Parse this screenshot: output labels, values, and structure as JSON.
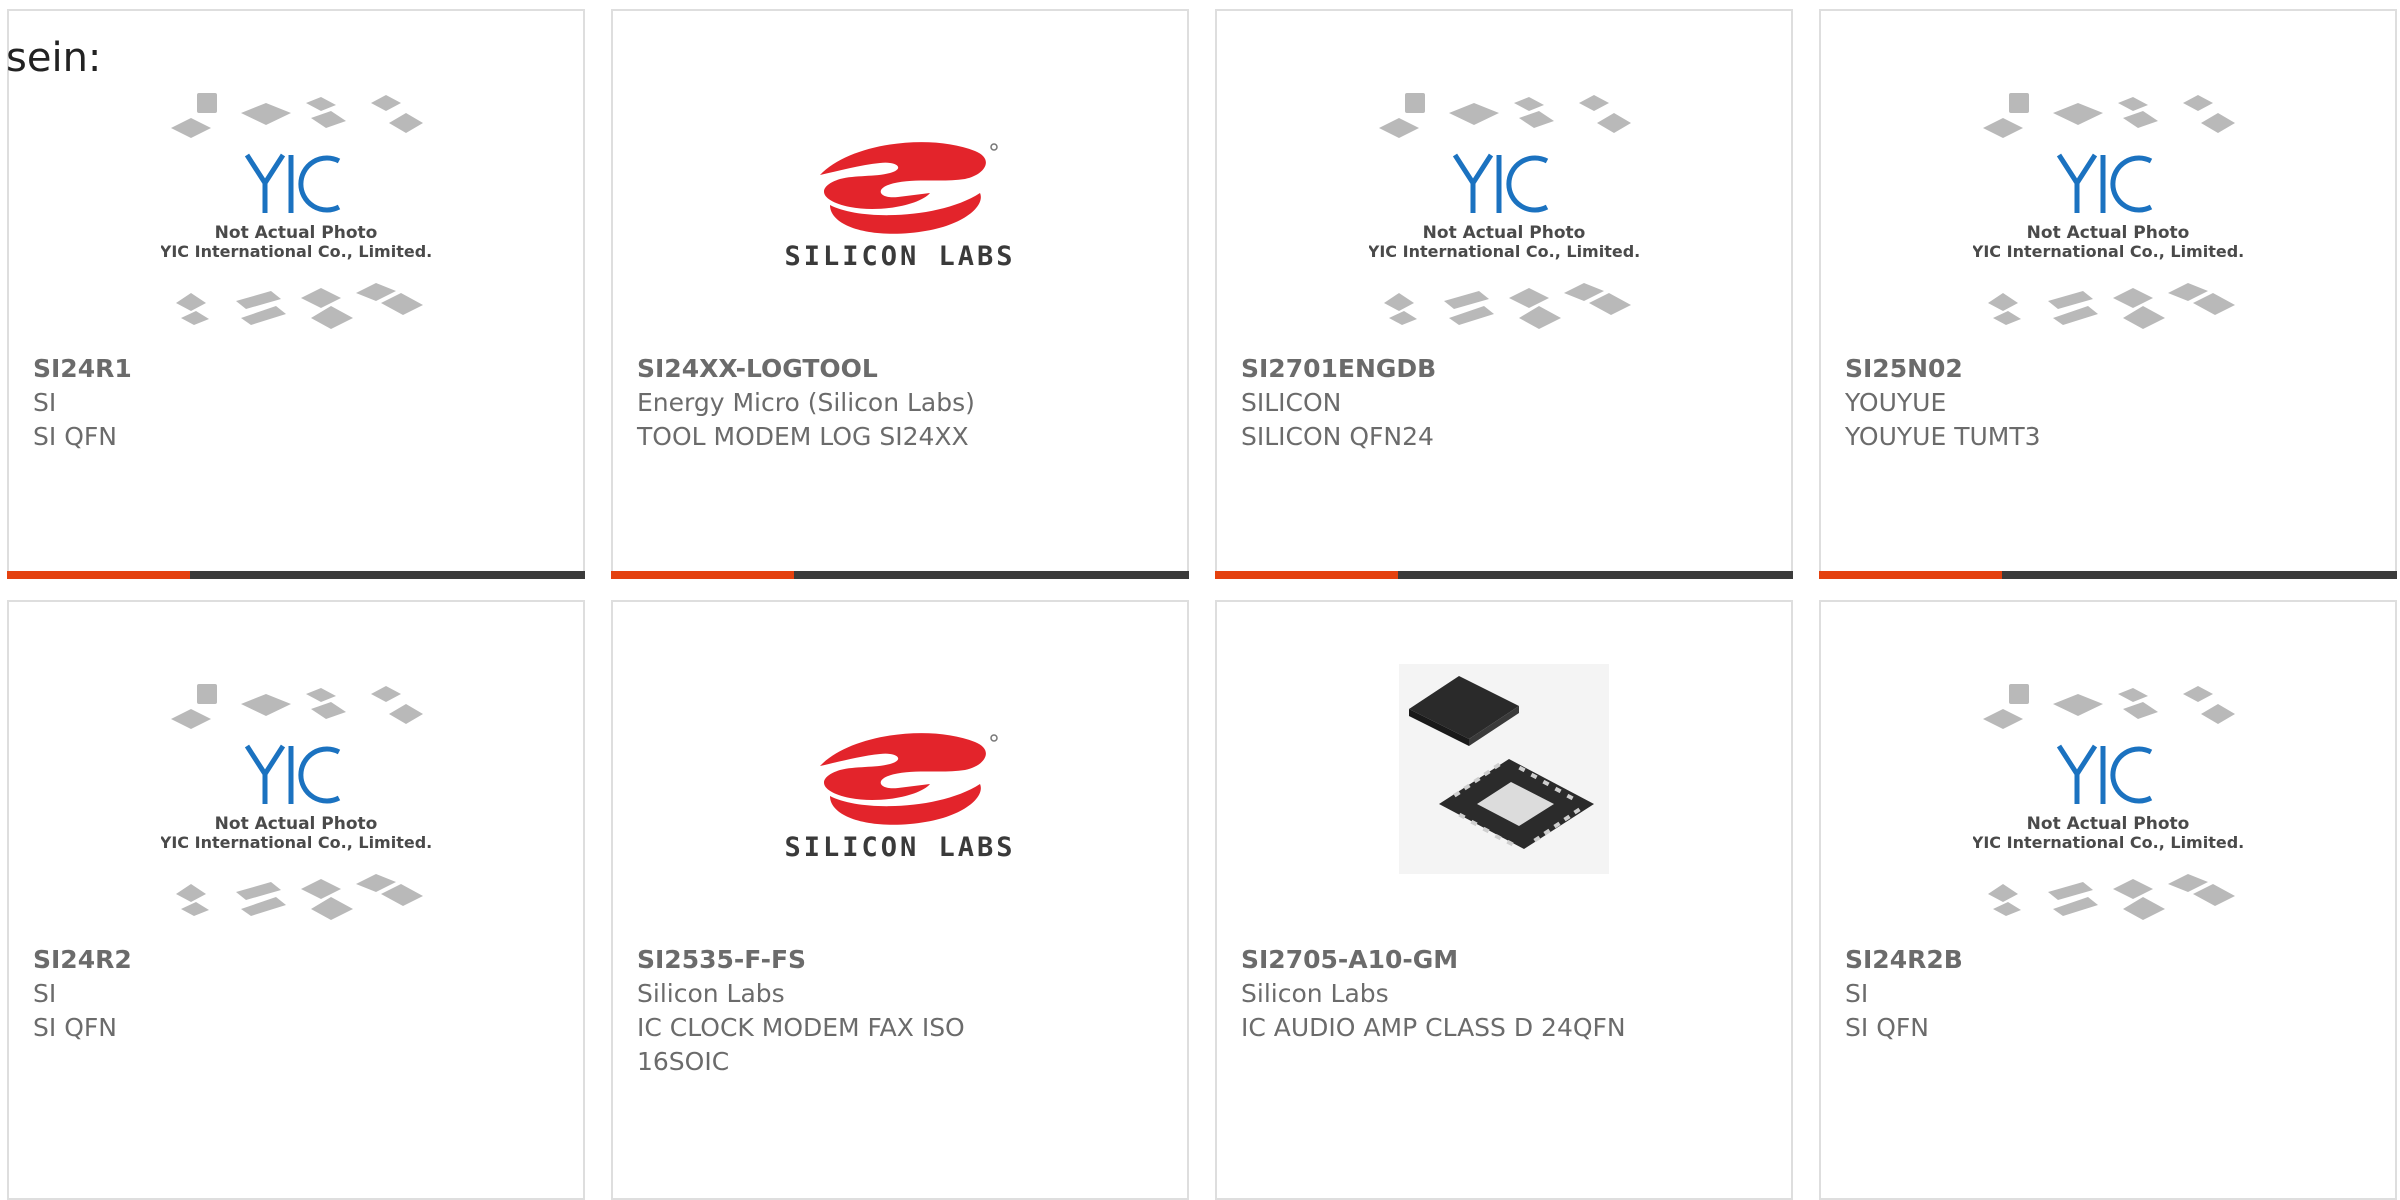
{
  "intro_text": "sein:",
  "placeholder": {
    "line1": "Not Actual Photo",
    "line2": "YIC International Co., Limited.",
    "brand": "YIC"
  },
  "logo": {
    "brand_text": "SILICON LABS"
  },
  "colors": {
    "accent": "#e4410f",
    "bar": "#3b3b3b",
    "text": "#6b6b6b",
    "border": "#dedede",
    "logo_red": "#e3242b",
    "yic_blue": "#1b72c0"
  },
  "products": [
    {
      "part": "SI24R1",
      "maker": "SI",
      "desc": "SI QFN",
      "image": "yic-placeholder"
    },
    {
      "part": "SI24XX-LOGTOOL",
      "maker": "Energy Micro (Silicon Labs)",
      "desc": "TOOL MODEM LOG SI24XX",
      "image": "silicon-labs-logo"
    },
    {
      "part": "SI2701ENGDB",
      "maker": "SILICON",
      "desc": "SILICON QFN24",
      "image": "yic-placeholder"
    },
    {
      "part": "SI25N02",
      "maker": "YOUYUE",
      "desc": "YOUYUE TUMT3",
      "image": "yic-placeholder"
    },
    {
      "part": "SI24R2",
      "maker": "SI",
      "desc": "SI QFN",
      "image": "yic-placeholder"
    },
    {
      "part": "SI2535-F-FS",
      "maker": "Silicon Labs",
      "desc": "IC CLOCK MODEM FAX ISO",
      "desc2": "16SOIC",
      "image": "silicon-labs-logo"
    },
    {
      "part": "SI2705-A10-GM",
      "maker": "Silicon Labs",
      "desc": "IC AUDIO AMP CLASS D 24QFN",
      "image": "qfn-chip-photo"
    },
    {
      "part": "SI24R2B",
      "maker": "SI",
      "desc": "SI QFN",
      "image": "yic-placeholder"
    }
  ]
}
